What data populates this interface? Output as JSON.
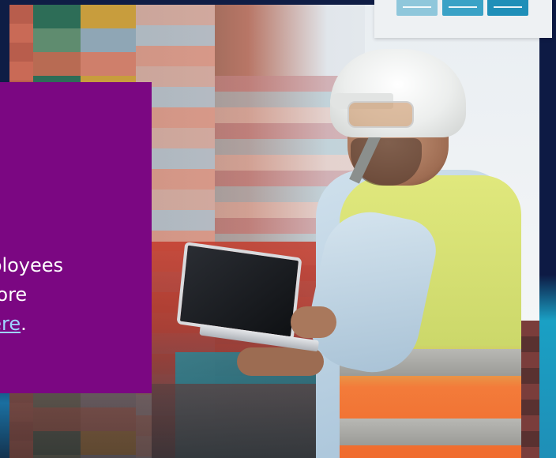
{
  "card": {
    "line1": "nployees",
    "line2": " more",
    "link_text": " here",
    "link_suffix": ".",
    "background": "#7b0782",
    "link_color": "#9fd4ff"
  },
  "widget": {
    "buttons": [
      {
        "icon": "bar-line-icon",
        "color": "#8fc7db"
      },
      {
        "icon": "bar-line-icon",
        "color": "#3aa2c6"
      },
      {
        "icon": "bar-line-icon",
        "color": "#1f8fb8"
      }
    ]
  },
  "photo": {
    "subject": "worker-with-laptop-at-port",
    "colors": {
      "helmet": "#ffffff",
      "vest_yellow": "#d5df72",
      "vest_orange": "#f06b2d",
      "background_navy": "#0f1d45"
    }
  }
}
